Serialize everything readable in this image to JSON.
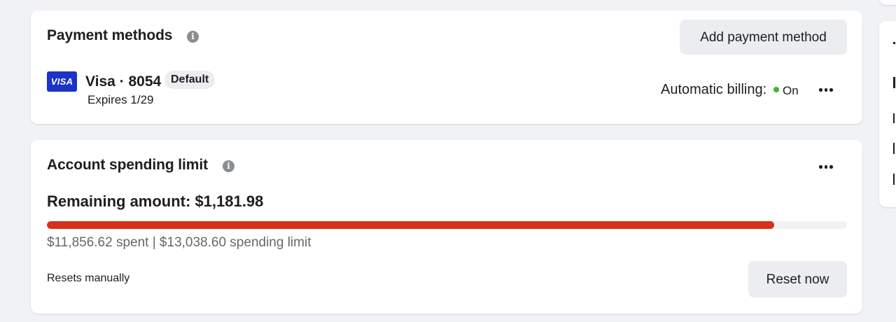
{
  "payment_methods": {
    "title": "Payment methods",
    "info_icon": "info-icon",
    "add_button_label": "Add payment method",
    "card": {
      "logo_text": "VISA",
      "name": "Visa · 8054",
      "badge": "Default",
      "expires": "Expires 1/29",
      "brand_color": "#1a33c9"
    },
    "automatic_billing_label": "Automatic billing:",
    "automatic_billing_status": "On",
    "status_color": "#42b72a",
    "more_icon": "more-horizontal-icon"
  },
  "spending_limit": {
    "title": "Account spending limit",
    "info_icon": "info-icon",
    "more_icon": "more-horizontal-icon",
    "remaining_label": "Remaining amount: $1,181.98",
    "spent_summary": "$11,856.62 spent | $13,038.60 spending limit",
    "progress_fraction": 0.909,
    "progress_color": "#d6311a",
    "resets_label": "Resets manually",
    "reset_button_label": "Reset now"
  }
}
